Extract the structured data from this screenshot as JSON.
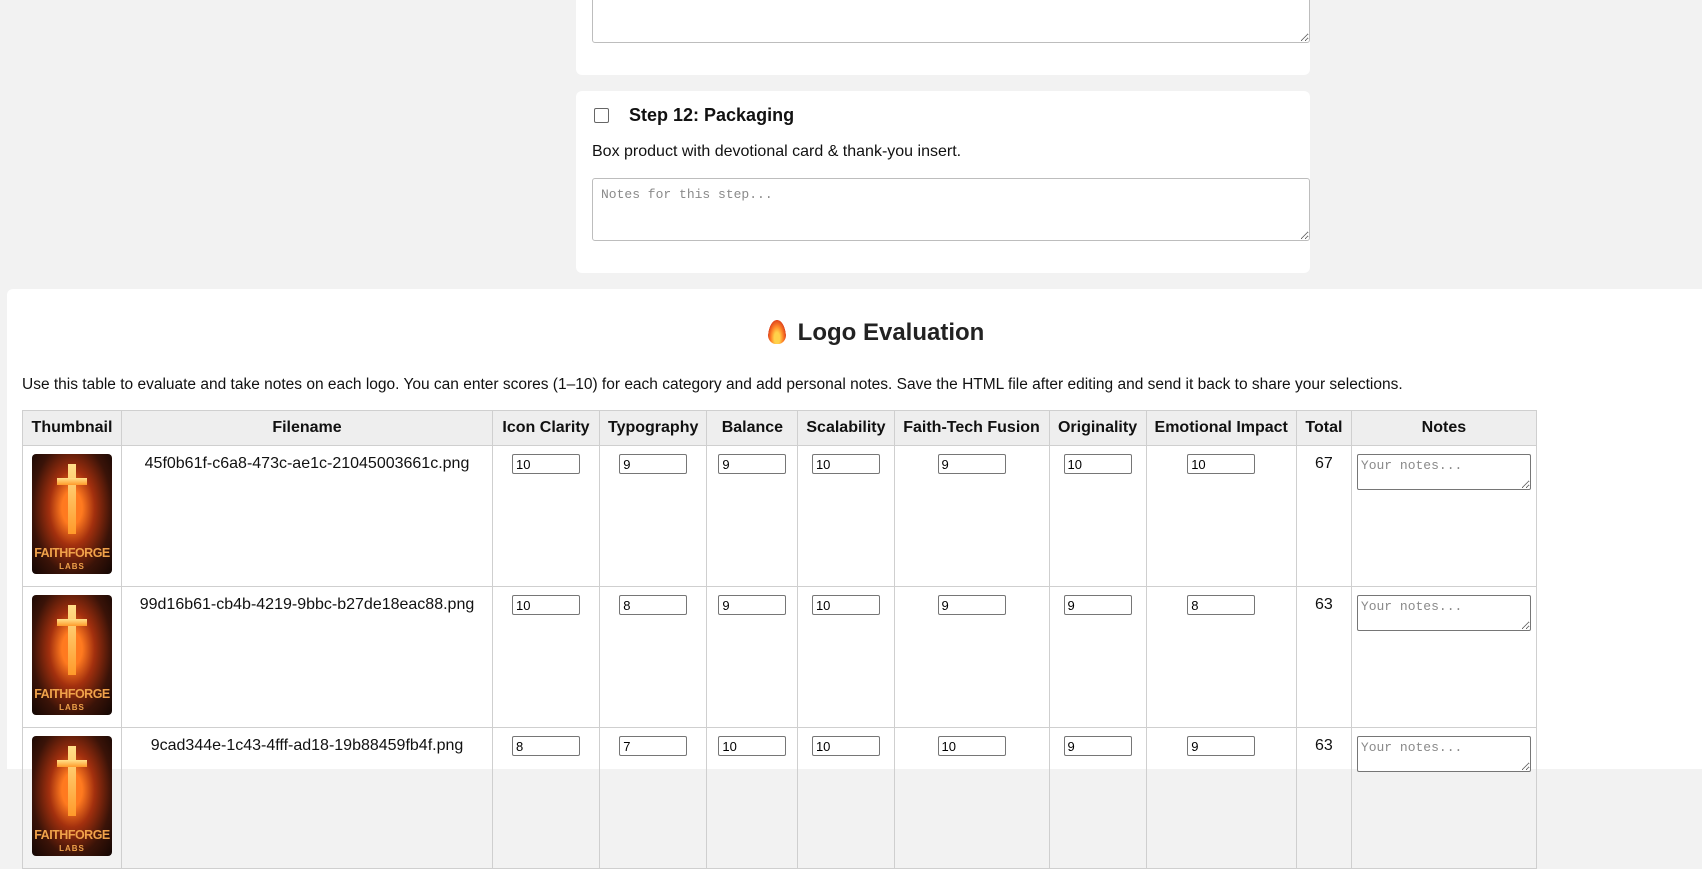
{
  "prev_step": {
    "notes_placeholder": "Notes for this step..."
  },
  "step12": {
    "title": "Step 12: Packaging",
    "description": "Box product with devotional card & thank-you insert.",
    "notes_placeholder": "Notes for this step..."
  },
  "evaluation": {
    "title": "Logo Evaluation",
    "title_icon": "flame-icon",
    "description": "Use this table to evaluate and take notes on each logo. You can enter scores (1–10) for each category and add personal notes. Save the HTML file after editing and send it back to share your selections.",
    "columns": [
      "Thumbnail",
      "Filename",
      "Icon Clarity",
      "Typography",
      "Balance",
      "Scalability",
      "Faith-Tech Fusion",
      "Originality",
      "Emotional Impact",
      "Total",
      "Notes"
    ],
    "notes_placeholder": "Your notes...",
    "thumbnail_brand": "FAITHFORGE",
    "thumbnail_brand_sub": "LABS",
    "rows": [
      {
        "filename": "45f0b61f-c6a8-473c-ae1c-21045003661c.png",
        "scores": [
          "10",
          "9",
          "9",
          "10",
          "9",
          "10",
          "10"
        ],
        "total": "67"
      },
      {
        "filename": "99d16b61-cb4b-4219-9bbc-b27de18eac88.png",
        "scores": [
          "10",
          "8",
          "9",
          "10",
          "9",
          "9",
          "8"
        ],
        "total": "63"
      },
      {
        "filename": "9cad344e-1c43-4fff-ad18-19b88459fb4f.png",
        "scores": [
          "8",
          "7",
          "10",
          "10",
          "10",
          "9",
          "9"
        ],
        "total": "63"
      }
    ]
  }
}
